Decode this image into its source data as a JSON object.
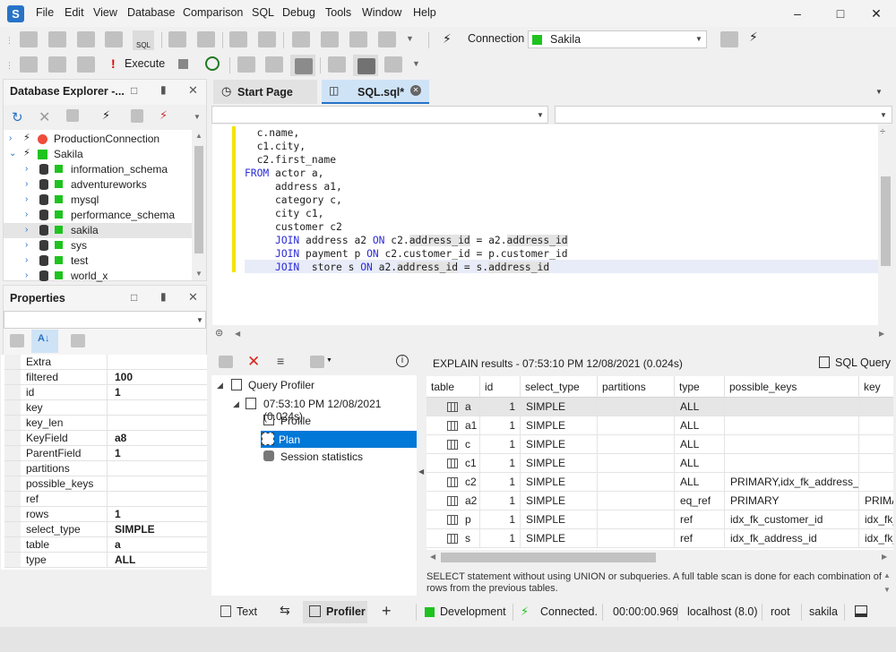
{
  "menu": [
    "File",
    "Edit",
    "View",
    "Database",
    "Comparison",
    "SQL",
    "Debug",
    "Tools",
    "Window",
    "Help"
  ],
  "toolbar": {
    "connection_label": "Connection",
    "connection_value": "Sakila",
    "execute_label": "Execute"
  },
  "db_explorer": {
    "title": "Database Explorer -...",
    "connections": [
      {
        "name": "ProductionConnection",
        "status_color": "#ef4c3c"
      },
      {
        "name": "Sakila",
        "status_color": "#1ec31e"
      }
    ],
    "databases": [
      "information_schema",
      "adventureworks",
      "mysql",
      "performance_schema",
      "sakila",
      "sys",
      "test",
      "world_x"
    ],
    "selected": "sakila"
  },
  "properties": {
    "title": "Properties",
    "rows": [
      {
        "key": "Extra",
        "value": ""
      },
      {
        "key": "filtered",
        "value": "100"
      },
      {
        "key": "id",
        "value": "1"
      },
      {
        "key": "key",
        "value": ""
      },
      {
        "key": "key_len",
        "value": ""
      },
      {
        "key": "KeyField",
        "value": "a8"
      },
      {
        "key": "ParentField",
        "value": "1"
      },
      {
        "key": "partitions",
        "value": ""
      },
      {
        "key": "possible_keys",
        "value": ""
      },
      {
        "key": "ref",
        "value": ""
      },
      {
        "key": "rows",
        "value": "1"
      },
      {
        "key": "select_type",
        "value": "SIMPLE"
      },
      {
        "key": "table",
        "value": "a"
      },
      {
        "key": "type",
        "value": "ALL"
      }
    ]
  },
  "tabs": [
    {
      "label": "Start Page",
      "active": false
    },
    {
      "label": "SQL.sql*",
      "active": true
    }
  ],
  "editor": {
    "lines": [
      [
        {
          "t": "  c.name,",
          "k": false
        }
      ],
      [
        {
          "t": "  c1.city,",
          "k": false
        }
      ],
      [
        {
          "t": "  c2.first_name",
          "k": false
        }
      ],
      [
        {
          "t": "FROM",
          "k": true
        },
        {
          "t": " actor a,",
          "k": false
        }
      ],
      [
        {
          "t": "     address a1,",
          "k": false
        }
      ],
      [
        {
          "t": "     category c,",
          "k": false
        }
      ],
      [
        {
          "t": "     city c1,",
          "k": false
        }
      ],
      [
        {
          "t": "     customer c2",
          "k": false
        }
      ],
      [
        {
          "t": "     ",
          "k": false
        },
        {
          "t": "JOIN",
          "k": true
        },
        {
          "t": " address a2 ",
          "k": false
        },
        {
          "t": "ON",
          "k": true
        },
        {
          "t": " c2.",
          "k": false
        },
        {
          "t": "address_id",
          "k": false,
          "h": true
        },
        {
          "t": " = a2.",
          "k": false
        },
        {
          "t": "address_id",
          "k": false,
          "h": true
        }
      ],
      [
        {
          "t": "     ",
          "k": false
        },
        {
          "t": "JOIN",
          "k": true
        },
        {
          "t": " payment p ",
          "k": false
        },
        {
          "t": "ON",
          "k": true
        },
        {
          "t": " c2.customer_id = p.customer_id",
          "k": false
        }
      ],
      [
        {
          "t": "     ",
          "k": false
        },
        {
          "t": "JOIN",
          "k": true
        },
        {
          "t": "  store s ",
          "k": false
        },
        {
          "t": "ON",
          "k": true
        },
        {
          "t": " a2.",
          "k": false
        },
        {
          "t": "address_id",
          "k": false,
          "h": true
        },
        {
          "t": " = s.",
          "k": false
        },
        {
          "t": "address_id",
          "k": false,
          "h": true
        }
      ]
    ]
  },
  "profiler": {
    "root": "Query Profiler",
    "run": "07:53:10 PM 12/08/2021 (0.024s)",
    "items": [
      "Profile",
      "Plan",
      "Session statistics"
    ],
    "selected": "Plan"
  },
  "explain": {
    "title": "EXPLAIN results - 07:53:10 PM 12/08/2021 (0.024s)",
    "sql_query_label": "SQL Query",
    "columns": [
      "table",
      "id",
      "select_type",
      "partitions",
      "type",
      "possible_keys",
      "key"
    ],
    "rows": [
      [
        "a",
        "1",
        "SIMPLE",
        "",
        "ALL",
        "",
        ""
      ],
      [
        "a1",
        "1",
        "SIMPLE",
        "",
        "ALL",
        "",
        ""
      ],
      [
        "c",
        "1",
        "SIMPLE",
        "",
        "ALL",
        "",
        ""
      ],
      [
        "c1",
        "1",
        "SIMPLE",
        "",
        "ALL",
        "",
        ""
      ],
      [
        "c2",
        "1",
        "SIMPLE",
        "",
        "ALL",
        "PRIMARY,idx_fk_address_id",
        ""
      ],
      [
        "a2",
        "1",
        "SIMPLE",
        "",
        "eq_ref",
        "PRIMARY",
        "PRIMA"
      ],
      [
        "p",
        "1",
        "SIMPLE",
        "",
        "ref",
        "idx_fk_customer_id",
        "idx_fk_"
      ],
      [
        "s",
        "1",
        "SIMPLE",
        "",
        "ref",
        "idx_fk_address_id",
        "idx_fk_"
      ]
    ],
    "description": "SELECT statement without using UNION or subqueries. A full table scan is done for each combination of rows from the previous tables."
  },
  "bottom_tabs": {
    "text": "Text",
    "profiler": "Profiler"
  },
  "status": {
    "mode": "Development",
    "connection": "Connected.",
    "elapsed": "00:00:00.969",
    "host": "localhost (8.0)",
    "user": "root",
    "database": "sakila"
  }
}
